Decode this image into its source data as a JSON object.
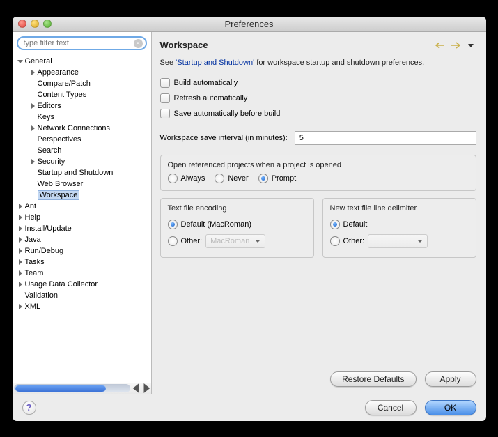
{
  "window": {
    "title": "Preferences"
  },
  "filter": {
    "placeholder": "type filter text"
  },
  "tree": [
    {
      "label": "General",
      "depth": 0,
      "expanded": true
    },
    {
      "label": "Appearance",
      "depth": 1,
      "expanded": false,
      "hasChildren": true
    },
    {
      "label": "Compare/Patch",
      "depth": 1
    },
    {
      "label": "Content Types",
      "depth": 1
    },
    {
      "label": "Editors",
      "depth": 1,
      "expanded": false,
      "hasChildren": true
    },
    {
      "label": "Keys",
      "depth": 1
    },
    {
      "label": "Network Connections",
      "depth": 1,
      "expanded": false,
      "hasChildren": true
    },
    {
      "label": "Perspectives",
      "depth": 1
    },
    {
      "label": "Search",
      "depth": 1
    },
    {
      "label": "Security",
      "depth": 1,
      "expanded": false,
      "hasChildren": true
    },
    {
      "label": "Startup and Shutdown",
      "depth": 1
    },
    {
      "label": "Web Browser",
      "depth": 1
    },
    {
      "label": "Workspace",
      "depth": 1,
      "selected": true
    },
    {
      "label": "Ant",
      "depth": 0,
      "expanded": false,
      "hasChildren": true
    },
    {
      "label": "Help",
      "depth": 0,
      "expanded": false,
      "hasChildren": true
    },
    {
      "label": "Install/Update",
      "depth": 0,
      "expanded": false,
      "hasChildren": true
    },
    {
      "label": "Java",
      "depth": 0,
      "expanded": false,
      "hasChildren": true
    },
    {
      "label": "Run/Debug",
      "depth": 0,
      "expanded": false,
      "hasChildren": true
    },
    {
      "label": "Tasks",
      "depth": 0,
      "expanded": false,
      "hasChildren": true
    },
    {
      "label": "Team",
      "depth": 0,
      "expanded": false,
      "hasChildren": true
    },
    {
      "label": "Usage Data Collector",
      "depth": 0,
      "expanded": false,
      "hasChildren": true
    },
    {
      "label": "Validation",
      "depth": 0
    },
    {
      "label": "XML",
      "depth": 0,
      "expanded": false,
      "hasChildren": true
    }
  ],
  "page": {
    "heading": "Workspace",
    "desc_prefix": "See ",
    "desc_link": "'Startup and Shutdown'",
    "desc_suffix": " for workspace startup and shutdown preferences.",
    "checks": {
      "build_auto": "Build automatically",
      "refresh_auto": "Refresh automatically",
      "save_auto": "Save automatically before build"
    },
    "interval_label": "Workspace save interval (in minutes):",
    "interval_value": "5",
    "open_ref": {
      "title": "Open referenced projects when a project is opened",
      "always": "Always",
      "never": "Never",
      "prompt": "Prompt"
    },
    "encoding": {
      "title": "Text file encoding",
      "default": "Default (MacRoman)",
      "other": "Other:",
      "other_value": "MacRoman"
    },
    "delimiter": {
      "title": "New text file line delimiter",
      "default": "Default",
      "other": "Other:"
    },
    "buttons": {
      "restore": "Restore Defaults",
      "apply": "Apply",
      "cancel": "Cancel",
      "ok": "OK"
    }
  }
}
